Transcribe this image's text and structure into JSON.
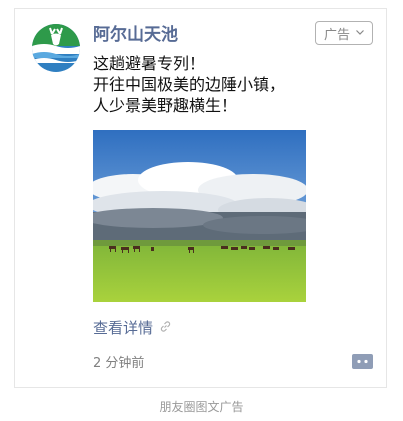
{
  "ad": {
    "account_name": "阿尔山天池",
    "badge_label": "广告",
    "text_lines": [
      "这趟避暑专列！",
      "开往中国极美的边陲小镇，",
      "人少景美野趣横生！"
    ],
    "link_label": "查看详情",
    "time": "2 分钟前"
  },
  "footer": {
    "caption": "朋友圈图文广告"
  },
  "icons": {
    "avatar": "deer-logo-icon",
    "badge_chevron": "chevron-down-icon",
    "link": "link-icon",
    "comment": "comment-icon"
  },
  "colors": {
    "account_name": "#576b95",
    "link": "#576b95",
    "avatar_green": "#2e9a4a",
    "avatar_blue": "#2f7fc1"
  }
}
